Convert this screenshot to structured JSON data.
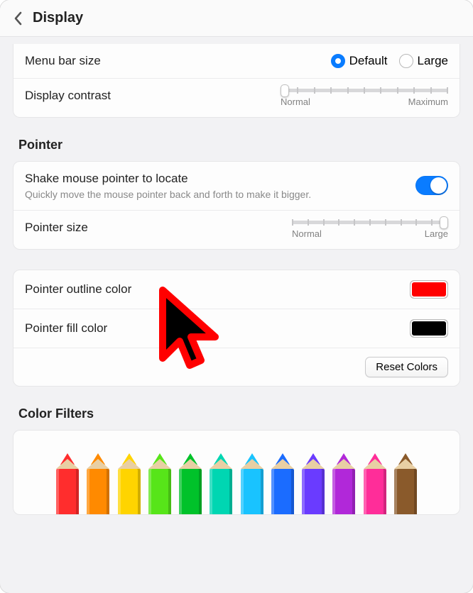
{
  "header": {
    "title": "Display"
  },
  "menu_bar": {
    "label": "Menu bar size",
    "options": {
      "default": "Default",
      "large": "Large"
    },
    "selected": "default"
  },
  "contrast": {
    "label": "Display contrast",
    "min_label": "Normal",
    "max_label": "Maximum",
    "value_percent": 0
  },
  "pointer_section": "Pointer",
  "shake": {
    "label": "Shake mouse pointer to locate",
    "sub": "Quickly move the mouse pointer back and forth to make it bigger.",
    "on": true
  },
  "pointer_size": {
    "label": "Pointer size",
    "min_label": "Normal",
    "max_label": "Large",
    "value_percent": 100
  },
  "outline": {
    "label": "Pointer outline color",
    "color": "#ff0000"
  },
  "fill": {
    "label": "Pointer fill color",
    "color": "#000000"
  },
  "reset_colors": "Reset Colors",
  "color_filters_section": "Color Filters",
  "pencil_colors": [
    "#ff2d2d",
    "#ff8a00",
    "#ffd400",
    "#57e519",
    "#00c22a",
    "#00d6b2",
    "#19c3ff",
    "#1b6cff",
    "#6a3bff",
    "#b128d9",
    "#ff2d99",
    "#8a5a2b"
  ]
}
